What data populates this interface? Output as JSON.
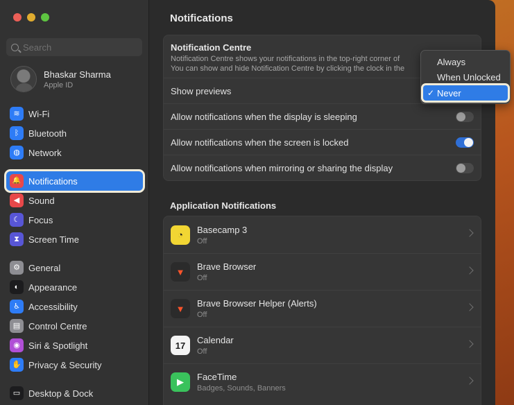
{
  "sidebar": {
    "search_placeholder": "Search",
    "account": {
      "name": "Bhaskar Sharma",
      "subtitle": "Apple ID"
    },
    "group1": [
      {
        "label": "Wi-Fi",
        "icon": "wifi-icon",
        "color": "#2e7cf6",
        "glyph": "≋"
      },
      {
        "label": "Bluetooth",
        "icon": "bluetooth-icon",
        "color": "#2e7cf6",
        "glyph": "ᛒ"
      },
      {
        "label": "Network",
        "icon": "globe-icon",
        "color": "#2e7cf6",
        "glyph": "◍"
      }
    ],
    "selected": {
      "label": "Notifications",
      "icon": "bell-icon",
      "color": "#e8484a",
      "glyph": "🔔"
    },
    "group2": [
      {
        "label": "Sound",
        "icon": "speaker-icon",
        "color": "#e8484a",
        "glyph": "◀"
      },
      {
        "label": "Focus",
        "icon": "moon-icon",
        "color": "#5856d6",
        "glyph": "☾"
      },
      {
        "label": "Screen Time",
        "icon": "hourglass-icon",
        "color": "#5856d6",
        "glyph": "⧗"
      }
    ],
    "group3": [
      {
        "label": "General",
        "icon": "gear-icon",
        "color": "#8e8e93",
        "glyph": "⚙"
      },
      {
        "label": "Appearance",
        "icon": "appearance-icon",
        "color": "#1c1c1e",
        "glyph": "◐"
      },
      {
        "label": "Accessibility",
        "icon": "accessibility-icon",
        "color": "#2e7cf6",
        "glyph": "♿"
      },
      {
        "label": "Control Centre",
        "icon": "control-centre-icon",
        "color": "#8e8e93",
        "glyph": "▤"
      },
      {
        "label": "Siri & Spotlight",
        "icon": "siri-icon",
        "color": "#b04fd6",
        "glyph": "◉"
      },
      {
        "label": "Privacy & Security",
        "icon": "hand-icon",
        "color": "#2e7cf6",
        "glyph": "✋"
      }
    ],
    "group4": [
      {
        "label": "Desktop & Dock",
        "icon": "dock-icon",
        "color": "#1c1c1e",
        "glyph": "▭"
      }
    ]
  },
  "main": {
    "title": "Notifications",
    "notification_centre": {
      "title": "Notification Centre",
      "desc_line1": "Notification Centre shows your notifications in the top-right corner of",
      "desc_line2": "You can show and hide Notification Centre by clicking the clock in the"
    },
    "rows": [
      {
        "label": "Show previews"
      },
      {
        "label": "Allow notifications when the display is sleeping",
        "on": false
      },
      {
        "label": "Allow notifications when the screen is locked",
        "on": true
      },
      {
        "label": "Allow notifications when mirroring or sharing the display",
        "on": false
      }
    ],
    "app_section_title": "Application Notifications",
    "apps": [
      {
        "name": "Basecamp 3",
        "status": "Off",
        "icon": "basecamp-icon",
        "bg": "#f2d633",
        "fg": "#1d1d1d",
        "glyph": "◔"
      },
      {
        "name": "Brave Browser",
        "status": "Off",
        "icon": "brave-lion-icon",
        "bg": "#2b2b2b",
        "fg": "#fb542b",
        "glyph": "▼"
      },
      {
        "name": "Brave Browser Helper (Alerts)",
        "status": "Off",
        "icon": "brave-lion-icon",
        "bg": "#2b2b2b",
        "fg": "#fb542b",
        "glyph": "▼"
      },
      {
        "name": "Calendar",
        "status": "Off",
        "icon": "calendar-icon",
        "bg": "#f4f4f4",
        "fg": "#1d1d1d",
        "glyph": "17"
      },
      {
        "name": "FaceTime",
        "status": "Badges, Sounds, Banners",
        "icon": "facetime-icon",
        "bg": "#3ac25c",
        "fg": "#ffffff",
        "glyph": "▶"
      }
    ]
  },
  "dropdown": {
    "options": [
      "Always",
      "When Unlocked",
      "Never"
    ],
    "selected": "Never",
    "check_glyph": "✓"
  }
}
